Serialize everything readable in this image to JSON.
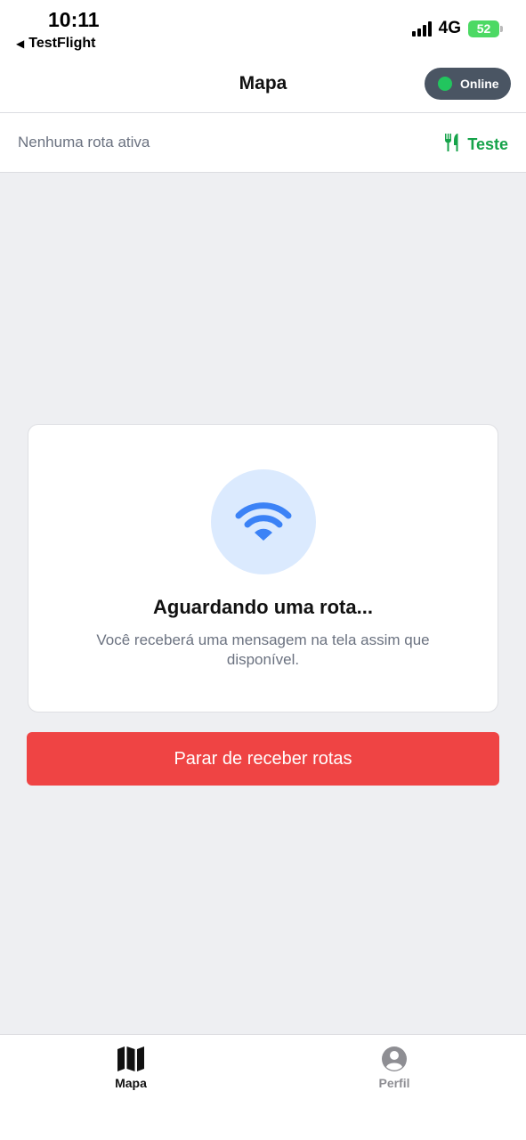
{
  "status_bar": {
    "time": "10:11",
    "back_app": "TestFlight",
    "network": "4G",
    "battery": "52"
  },
  "header": {
    "title": "Mapa",
    "status_label": "Online",
    "status_color": "#22c55e"
  },
  "route": {
    "status": "Nenhuma rota ativa",
    "restaurant_label": "Teste",
    "restaurant_icon": "utensils-icon"
  },
  "waiting_card": {
    "icon": "wifi-icon",
    "title": "Aguardando uma rota...",
    "message": "Você receberá uma mensagem na tela assim que disponível."
  },
  "stop_button": {
    "label": "Parar de receber rotas",
    "color": "#ef4444"
  },
  "tabs": [
    {
      "label": "Mapa",
      "icon": "map-icon",
      "active": true
    },
    {
      "label": "Perfil",
      "icon": "user-circle-icon",
      "active": false
    }
  ]
}
